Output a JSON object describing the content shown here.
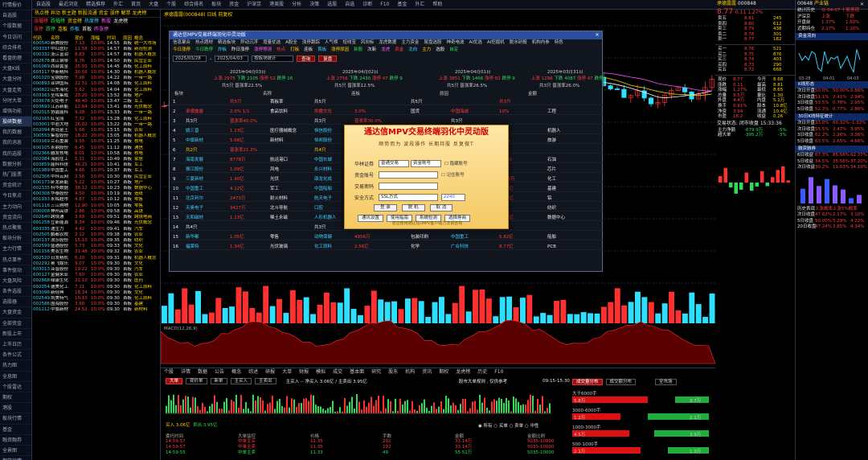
{
  "nav": [
    "行情报价",
    "自选股",
    "个股数据",
    "今日访问",
    "综合排名",
    "看盘助理",
    "大盘K线",
    "大盘分时",
    "大盘走势",
    "分时大单",
    "增强功能",
    "投研数据",
    "我的数据",
    "我的消息",
    "我的选股",
    "数据分析",
    "热门股票",
    "资金统计",
    "今日焦点",
    "主力动向",
    "资金流向",
    "热点聚焦",
    "板块分析",
    "主力行情",
    "热点事件",
    "事件驱动",
    "大盘风险",
    "条件选股",
    "选股器",
    "大盘资金",
    "全部资金",
    "新股上市",
    "上市日历",
    "条件公式",
    "热力图",
    "全息图",
    "个股雷达",
    "期权",
    "港股",
    "板块行情",
    "基金",
    "融资融券",
    "全景图",
    "期货行情"
  ],
  "topbar": {
    "items": [
      "自选股",
      "最近浏览",
      "精选推荐",
      "外汇",
      "首页",
      "大盘",
      "个股",
      "综合排名",
      "板块",
      "资金",
      "沪深京",
      "港美股",
      "分析",
      "决策",
      "选股",
      "自选",
      "诊断",
      "F10",
      "基金",
      "外汇",
      "帮助"
    ],
    "close": "✕"
  },
  "left": {
    "header": "热点榜   异动   新主题   新股流通   资金   涨停   解禁  龙虎榜",
    "tabs": [
      {
        "t": "涨幅榜",
        "c": "red"
      },
      {
        "t": "跌幅榜",
        "c": "grn"
      },
      {
        "t": "资金榜",
        "c": "yel"
      },
      {
        "t": "热度榜",
        "c": "cyn"
      },
      {
        "t": "新股",
        "c": "mag"
      },
      {
        "t": "龙虎榜",
        "c": "wht"
      }
    ],
    "tabs2": [
      {
        "t": "涨停",
        "c": "red"
      },
      {
        "t": "跌停",
        "c": "grn"
      },
      {
        "t": "连板",
        "c": "yel"
      },
      {
        "t": "炸板",
        "c": "cyn"
      },
      {
        "t": "首板",
        "c": "wht"
      },
      {
        "t": "昨涨停",
        "c": "mag"
      }
    ],
    "cols": [
      "代码",
      "名称",
      "现价",
      "涨幅",
      "时间",
      "原因",
      "概念"
    ],
    "rows": [
      [
        "600540",
        "新赛股份",
        "7.13",
        "10.0%",
        "14:55",
        "首板",
        "统一大市场"
      ],
      [
        "603337",
        "中红医疗",
        "11.58",
        "10.0%",
        "14:57",
        "首板",
        "新冠检测"
      ],
      [
        "600332",
        "浙江富润",
        "8.83",
        "10.0%",
        "14:57",
        "首板",
        "机器人概念"
      ],
      [
        "002678",
        "珠江钢琴",
        "8.76",
        "10.0%",
        "14:50",
        "首板",
        "民营企业"
      ],
      [
        "601069",
        "西部黄金",
        "25.01",
        "10.0%",
        "14:45",
        "首板",
        "化工原料"
      ],
      [
        "603117",
        "华新精科",
        "30.56",
        "10.0%",
        "14:30",
        "首板",
        "机器人概念"
      ],
      [
        "601020",
        "宝钢股份",
        "7.98",
        "10.0%",
        "14:22",
        "首板",
        "一带一路"
      ],
      [
        "000893",
        "亚钾国际",
        "22.51",
        "10.0%",
        "14:08",
        "首板",
        "化工原料"
      ],
      [
        "000822",
        "山东海化",
        "5.62",
        "10.0%",
        "14:04",
        "首板",
        "化工原料"
      ],
      [
        "603163",
        "圣晖集成",
        "23.20",
        "10.0%",
        "13:52",
        "首板",
        "地产"
      ],
      [
        "603678",
        "火炬电子",
        "48.40",
        "10.0%",
        "13:47",
        "二板",
        "军工"
      ],
      [
        "603693",
        "江苏新能",
        "12.64",
        "10.0%",
        "13:41",
        "首板",
        "光伏概念"
      ],
      [
        "002015",
        "协鑫能科",
        "9.28",
        "10.0%",
        "13:33",
        "首板",
        "一带一路"
      ],
      [
        "002165",
        "红宝丽",
        "7.32",
        "10.0%",
        "13:28",
        "首板",
        "化工原料"
      ],
      [
        "003001",
        "中岩大地",
        "26.02",
        "10.0%",
        "13:22",
        "首板",
        "一带一路"
      ],
      [
        "002094",
        "青岛金王",
        "5.66",
        "10.0%",
        "13:15",
        "首板",
        "农业"
      ],
      [
        "300553",
        "集智股份",
        "18.22",
        "20.0%",
        "13:05",
        "首板",
        "机器人概念"
      ],
      [
        "603169",
        "兰石重装",
        "9.55",
        "10.0%",
        "11:25",
        "首板",
        "核电"
      ],
      [
        "600105",
        "永鼎股份",
        "6.45",
        "10.0%",
        "11:12",
        "首板",
        "通信"
      ],
      [
        "002366",
        "融发核电",
        "6.01",
        "10.0%",
        "10:58",
        "首板",
        "核电"
      ],
      [
        "002084",
        "海鸥住工",
        "5.31",
        "10.0%",
        "10:49",
        "首板",
        "家居"
      ],
      [
        "603859",
        "能科科技",
        "46.21",
        "10.0%",
        "10:41",
        "首板",
        "军工"
      ],
      [
        "601989",
        "中国重工",
        "4.66",
        "10.0%",
        "10:37",
        "首板",
        "军工"
      ],
      [
        "002306",
        "中科云网",
        "2.56",
        "10.0%",
        "10:30",
        "首板",
        "民营企业"
      ],
      [
        "600173",
        "卧龙新能",
        "5.22",
        "10.0%",
        "10:27",
        "首板",
        "地产"
      ],
      [
        "002335",
        "科华数据",
        "38.12",
        "10.0%",
        "10:23",
        "首板",
        "数据中心"
      ],
      [
        "600308",
        "华泰股份",
        "4.50",
        "10.0%",
        "10:19",
        "首板",
        "造纸"
      ],
      [
        "601933",
        "永辉超市",
        "4.87",
        "10.0%",
        "10:12",
        "首板",
        "零售"
      ],
      [
        "601116",
        "三江购物",
        "12.90",
        "10.0%",
        "10:05",
        "首板",
        "零售"
      ],
      [
        "000008",
        "神州高铁",
        "2.86",
        "10.0%",
        "09:58",
        "首板",
        "高铁"
      ],
      [
        "002640",
        "跨境通",
        "3.68",
        "10.0%",
        "09:51",
        "首板",
        "跨境电商"
      ],
      [
        "001258",
        "立新能源",
        "8.34",
        "10.0%",
        "09:46",
        "首板",
        "光伏概念"
      ],
      [
        "603335",
        "迪生力",
        "4.42",
        "10.0%",
        "09:41",
        "首板",
        "汽车"
      ],
      [
        "002505",
        "鹏都农牧",
        "2.12",
        "10.0%",
        "09:38",
        "首板",
        "农业"
      ],
      [
        "600137",
        "浪莎股份",
        "15.10",
        "10.0%",
        "09:35",
        "首板",
        "纺织"
      ],
      [
        "002599",
        "盛通股份",
        "5.73",
        "10.0%",
        "09:33",
        "首板",
        "文化"
      ],
      [
        "301156",
        "美农生物",
        "31.48",
        "20.0%",
        "09:32",
        "首板",
        "农业"
      ],
      [
        "002520",
        "日发精机",
        "6.20",
        "10.0%",
        "09:31",
        "首板",
        "机器人概念"
      ],
      [
        "002292",
        "奥飞娱乐",
        "9.07",
        "10.0%",
        "09:30",
        "首板",
        "文化"
      ],
      [
        "603013",
        "亚普股份",
        "19.22",
        "10.0%",
        "09:30",
        "首板",
        "汽车"
      ],
      [
        "600127",
        "金健米业",
        "7.60",
        "10.0%",
        "09:30",
        "首板",
        "农业"
      ],
      [
        "002868",
        "绿康生化",
        "22.10",
        "10.0%",
        "09:30",
        "首板",
        "医药"
      ],
      [
        "002054",
        "德美化工",
        "7.11",
        "10.0%",
        "09:30",
        "首板",
        "化工原料"
      ],
      [
        "603096",
        "新经典",
        "18.34",
        "10.0%",
        "09:30",
        "首板",
        "文化"
      ],
      [
        "002549",
        "凯美特气",
        "10.10",
        "10.0%",
        "09:30",
        "首板",
        "化工原料"
      ],
      [
        "002586",
        "围海股份",
        "3.60",
        "10.0%",
        "09:30",
        "首板",
        "基建"
      ],
      [
        "001212",
        "中旗新材",
        "24.52",
        "10.0%",
        "09:30",
        "首板",
        "新材料"
      ]
    ]
  },
  "stock": {
    "name": "承德露露",
    "code": "000848",
    "price": "8.77",
    "change": "0.11",
    "pct": "1.27%",
    "pct2": "1.28%",
    "title": "承德露露(000848) 日线 前复权",
    "macd": "MACD(12,26,9)"
  },
  "overlay": {
    "title": "通达信MPV交易终端羽化中灵动版",
    "menu": [
      "信息聚合",
      "热点题材",
      "精选板块",
      "异动沉浮",
      "增量优选",
      "A股全",
      "涨停跟踪",
      "人气榜",
      "短线宝",
      "风向标",
      "龙虎数据",
      "主力资金",
      "尾盘选股",
      "神奇电波",
      "AI优选",
      "AI挖掘机",
      "脱水研报",
      "机构内参",
      "特色"
    ],
    "tabs": [
      {
        "t": "今日涨停",
        "c": "yel"
      },
      {
        "t": "今日跌停",
        "c": "grn"
      },
      {
        "t": "炸板",
        "c": "cyn"
      },
      {
        "t": "昨日涨停",
        "c": "wht"
      },
      {
        "t": "涨停预测",
        "c": "mag"
      },
      {
        "t": "热点",
        "c": "red"
      },
      {
        "t": "打板",
        "c": "yel"
      },
      {
        "t": "连板",
        "c": "wht"
      },
      {
        "t": "首板",
        "c": "cyn"
      },
      {
        "t": "涨停原因",
        "c": "yel"
      },
      {
        "t": "新股",
        "c": "grn"
      },
      {
        "t": "次新",
        "c": "wht"
      },
      {
        "t": "龙虎",
        "c": "mag"
      },
      {
        "t": "资金",
        "c": "red"
      },
      {
        "t": "北向",
        "c": "cyn"
      },
      {
        "t": "主力",
        "c": "yel"
      },
      {
        "t": "选股",
        "c": "wht"
      },
      {
        "t": "自定",
        "c": "grn"
      }
    ],
    "filter": {
      "from": "2025/03/28",
      "to": "2025/04/03",
      "type": "按板块统计",
      "query": "查询",
      "review": "复盘"
    },
    "dates": [
      "2025年04月03日",
      "2025年04月02日",
      "2025年04月01日",
      "2025年03月31日"
    ],
    "summary": [
      {
        "a": "上涨 2975",
        "b": "下跌 2105",
        "c": "涨停 52",
        "d": "跌停 16"
      },
      {
        "a": "上涨 2756",
        "b": "下跌 2430",
        "c": "涨停 47",
        "d": "跌停 9"
      },
      {
        "a": "上涨 3851",
        "b": "下跌 1466",
        "c": "涨停 82",
        "d": "跌停 9"
      },
      {
        "a": "上涨 1296",
        "b": "下跌 4087",
        "c": "涨停 47",
        "d": "跌停 35"
      }
    ],
    "amount": [
      "共5只 普涨率22.5%",
      "共5只 普涨率12.5%",
      "共5只 普涨率26.5%",
      "共3只 普涨率26.0%"
    ],
    "headers": [
      "板块",
      "名称",
      "连板",
      "原因",
      "金额"
    ],
    "rows": [
      {
        "k": "1",
        "c": "wht",
        "v": [
          "",
          "共5只",
          "首板率",
          "共5只",
          "",
          "共5只",
          "",
          "共3只",
          ""
        ]
      },
      {
        "k": "2",
        "c": "red",
        "v": [
          "承德露露",
          "2.0% 1/1",
          "食品饮料",
          "凯撒文化",
          "3.0%",
          "国货",
          "中国海诚",
          "10%",
          "工程"
        ]
      },
      {
        "k": "3",
        "c": "wht",
        "v": [
          "共3只",
          "普涨率40.0%",
          "",
          "共3只",
          "普涨率30.0%",
          "",
          "共3只",
          "",
          ""
        ]
      },
      {
        "k": "4",
        "c": "cyn",
        "v": [
          "姚三晋",
          "1.13亿",
          "医疗器械概念",
          "恒信股份",
          "2.51亿",
          "ST",
          "浙江富润",
          "8.83",
          "机器人"
        ]
      },
      {
        "k": "5",
        "c": "cyn",
        "v": [
          "中旗新材",
          "5.68亿",
          "新材料",
          "恒邦股份",
          "2.0%",
          "黄金",
          "凯撒旅业",
          "5.5%",
          "旅游"
        ]
      },
      {
        "k": "6",
        "c": "yel",
        "v": [
          "共2只",
          "普涨率21.3%",
          "",
          "共4只",
          "普涨率21.3%",
          "",
          "共4只",
          "",
          ""
        ]
      },
      {
        "k": "7",
        "c": "cyn",
        "v": [
          "海南发展",
          "8778万",
          "航运港口",
          "中国长城",
          "1.19亿",
          "信创",
          "和顺石油",
          "48.40",
          "石油"
        ]
      },
      {
        "k": "8",
        "c": "cyn",
        "v": [
          "振江股份",
          "1.09亿",
          "风电",
          "永兴材料",
          "3.47亿",
          "锂电池",
          "华天科技",
          "",
          "芯片"
        ]
      },
      {
        "k": "9",
        "c": "cyn",
        "v": [
          "三夏新材",
          "1.90亿",
          "光伏",
          "康龙化成",
          "1.51亿",
          "医药",
          "光华股份",
          "3338万",
          "化工"
        ]
      },
      {
        "k": "10",
        "c": "cyn",
        "v": [
          "中国重工",
          "4.12亿",
          "军工",
          "中国船舶",
          "2.88亿",
          "军工",
          "中国中冶",
          "4.96亿",
          "基建"
        ]
      },
      {
        "k": "11",
        "c": "cyn",
        "v": [
          "北京利尔",
          "2473万",
          "耐火材料",
          "航天电子",
          "1.03亿",
          "航天",
          "宏创控股",
          "1.85亿",
          "铝"
        ]
      },
      {
        "k": "12",
        "c": "cyn",
        "v": [
          "天奥电子",
          "3427万",
          "北斗导航",
          "口腔",
          "3.47亿",
          "医疗",
          "江苏阳光",
          "",
          "纺织"
        ]
      },
      {
        "k": "13",
        "c": "cyn",
        "v": [
          "天和磁材",
          "1.13亿",
          "稀土永磁",
          "人形机器人",
          "",
          "",
          "大位科技",
          "8.33亿",
          "数据中心"
        ]
      },
      {
        "k": "14",
        "c": "wht",
        "v": [
          "共4只",
          "",
          "",
          "共3只",
          "",
          "",
          "共4只",
          "",
          ""
        ]
      },
      {
        "k": "15",
        "c": "cyn",
        "v": [
          "新华都",
          "1.05亿",
          "零售",
          "动物保健",
          "4956万",
          "包装印刷",
          "中国重工",
          "5.82亿",
          "船舶"
        ]
      },
      {
        "k": "16",
        "c": "cyn",
        "v": [
          "福莱特",
          "1.34亿",
          "光伏玻璃",
          "化工原料",
          "2.56亿",
          "化学",
          "广合科技",
          "8.77亿",
          "PCB"
        ]
      }
    ]
  },
  "login": {
    "title": "通达信MPV交易终端羽化中灵动版",
    "slogan": "顺势而为   波段操作   长期持股   反复做T",
    "fields": [
      {
        "label": "华林证券",
        "value": "普通交易",
        "value2": "资金账号",
        "chk": "隐藏账号"
      },
      {
        "label": "资金账号",
        "value": "",
        "chk": "记住账号"
      },
      {
        "label": "交易密码",
        "value": ""
      },
      {
        "label": "安全方式",
        "value": "SSL方式",
        "captcha": "2240"
      }
    ],
    "buttons": [
      "登 录",
      "脱 机",
      "取 消"
    ],
    "buttons2": [
      "通讯设置",
      "使用指南",
      "系统检测",
      "选择券商"
    ],
    "footer": "若您使用通达信/MPV客户端方法请咨询"
  },
  "tick": {
    "menu": [
      "个股",
      "详情",
      "数据",
      "公告",
      "概念",
      "综述",
      "研报",
      "大单",
      "财报",
      "模拟",
      "成交",
      "基本面",
      "研究",
      "股东",
      "机构",
      "资讯",
      "期权",
      "龙虎榜",
      "历史",
      "F10"
    ],
    "btns": [
      "大单",
      "现价单",
      "新单",
      "主买入",
      "主卖出"
    ],
    "info": "主买入 -- 净买入 3.06亿 / 主卖出 3.95亿",
    "right_label": "股市大单规则 , 仅供参考",
    "buy": "买入 3.06亿",
    "sell": "卖出 3.95亿",
    "time": "09:15-15:30",
    "radios": [
      "所有",
      "买单",
      "卖单",
      "中性"
    ],
    "cols": [
      "委托时间",
      "大单监控",
      "价格",
      "手数",
      "金额",
      "金额比例"
    ],
    "rows": [
      {
        "c": "red",
        "v": [
          "14:59:57",
          "中单主买",
          "11.35",
          "292",
          "33.14万",
          "5035-10000"
        ]
      },
      {
        "c": "red",
        "v": [
          "14:59:57",
          "中单主卖",
          "11.35",
          "292",
          "33.14万",
          "5035-10000"
        ]
      },
      {
        "c": "grn",
        "v": [
          "14:59:55",
          "中单主卖",
          "11.33",
          "49",
          "55.51万",
          "5035-10000"
        ]
      }
    ]
  },
  "dist": {
    "tabs": [
      "成交量分布",
      "成交额分布"
    ],
    "tag": "全市场",
    "rows": [
      {
        "label": "大于6000手",
        "r": 0.55,
        "g": 0.25,
        "rv": "5.8万",
        "gv": "3.7万"
      },
      {
        "label": "3000-6000手",
        "r": 0.35,
        "g": 0.45,
        "rv": "1.2万",
        "gv": "2.1万"
      },
      {
        "label": "1000-3000手",
        "r": 0.42,
        "g": 0.4,
        "rv": "4.5万",
        "gv": "3.9万"
      },
      {
        "label": "500-1000手",
        "r": 0.5,
        "g": 0.3,
        "rv": "2.1万",
        "gv": "1.3万"
      }
    ]
  },
  "quote": {
    "sell": [
      [
        "卖五",
        "8.81",
        "245"
      ],
      [
        "卖四",
        "8.80",
        "612"
      ],
      [
        "卖三",
        "8.79",
        "438"
      ],
      [
        "卖二",
        "8.78",
        "301"
      ],
      [
        "卖一",
        "8.77",
        "182"
      ]
    ],
    "buy": [
      [
        "买一",
        "8.76",
        "521"
      ],
      [
        "买二",
        "8.75",
        "876"
      ],
      [
        "买三",
        "8.74",
        "403"
      ],
      [
        "买四",
        "8.73",
        "290"
      ],
      [
        "买五",
        "8.72",
        "668"
      ]
    ],
    "stats": [
      [
        "现价",
        "8.77",
        "今开",
        "8.68"
      ],
      [
        "涨跌",
        "0.11",
        "最高",
        "8.81"
      ],
      [
        "涨幅",
        "1.27%",
        "最低",
        "8.65"
      ],
      [
        "总量",
        "9.5万",
        "量比",
        "1.30"
      ],
      [
        "外盘",
        "4.4万",
        "内盘",
        "5.1万"
      ],
      [
        "换手",
        "0.91%",
        "股本",
        "10.8亿"
      ],
      [
        "净资",
        "3.94",
        "流通",
        "10.4亿"
      ],
      [
        "市盈",
        "18.2",
        "收益",
        "0.26"
      ]
    ],
    "flow_title": "交易状态: 闭市收盘 15:33:36",
    "flow": [
      [
        "主力净额",
        "-679.9万",
        "-5%"
      ],
      [
        "超大单",
        "-395.2万",
        "-3%"
      ]
    ]
  },
  "r2": {
    "title": "产业链",
    "rows": [
      [
        "统计历史",
        "以 04-07 十股表现"
      ],
      [
        "沪深京",
        "上涨",
        "下跌"
      ],
      [
        "开盘前",
        "1.37%",
        "1.50%"
      ],
      [
        "近期持仓",
        "2.17%",
        "1.10%"
      ]
    ],
    "sec1": "资金流向",
    "sec2": "K线形态",
    "sec3": "30日K线特征统计",
    "sec4": "融资融券",
    "tbl": [
      [
        "次日开盘",
        "50.0%",
        "50.00%",
        "0.86%"
      ],
      [
        "次日收盘",
        "51.1%",
        "2.41%",
        "2.94%"
      ],
      [
        "3日收盘",
        "53.5%",
        "0.78%",
        "2.95%"
      ],
      [
        "5日收盘",
        "52.3%",
        "0.77%",
        "2.86%"
      ]
    ],
    "tbl2": [
      [
        "次日开盘",
        "33.0%",
        "60.32%",
        "-1.32%"
      ],
      [
        "次日收盘",
        "55.5%",
        "2.47%",
        "3.95%"
      ],
      [
        "3日收盘",
        "62.2%",
        "2.26%",
        "3.36%"
      ],
      [
        "5日收盘",
        "63.5%",
        "2.65%",
        "4.66%"
      ]
    ],
    "tbl3": [
      [
        "6日收益",
        "67.3%",
        "85.56%",
        "62.37%"
      ],
      [
        "5日收益",
        "34.5%",
        "35.56%",
        "37.20%"
      ],
      [
        "次日收益",
        "30.2%",
        "11.03%",
        "34.19%"
      ]
    ],
    "tbl4": [
      [
        "历史表现",
        "上涨概率",
        "上涨5%概率"
      ],
      [
        "次日收盘",
        "47.62%",
        "2.17%",
        "3.10%"
      ],
      [
        "5日收盘",
        "50.00%",
        "5.29%",
        "4.22%"
      ],
      [
        "20日收盘",
        "47.24%",
        "3.85%",
        "4.34%"
      ]
    ],
    "dates": [
      "03-28",
      "04-01",
      "04-03"
    ],
    "stamp": "00648"
  }
}
